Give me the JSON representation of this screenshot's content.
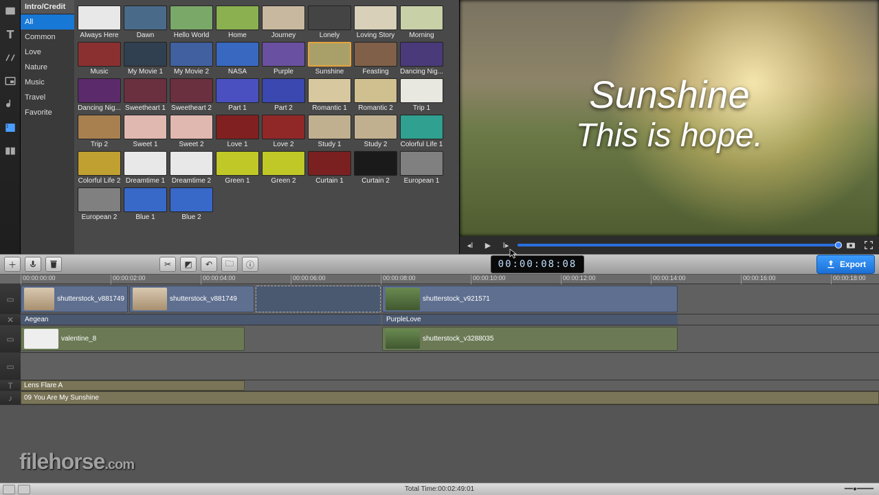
{
  "header_title": "Intro/Credit",
  "categories": [
    "All",
    "Common",
    "Love",
    "Nature",
    "Music",
    "Travel",
    "Favorite"
  ],
  "selected_category": 0,
  "templates": [
    {
      "label": "Always Here",
      "bg": "#e8e8e8"
    },
    {
      "label": "Dawn",
      "bg": "#4a6a8a"
    },
    {
      "label": "Hello World",
      "bg": "#7aa868"
    },
    {
      "label": "Home",
      "bg": "#8ab050"
    },
    {
      "label": "Journey",
      "bg": "#c8b8a0"
    },
    {
      "label": "Lonely",
      "bg": "#444"
    },
    {
      "label": "Loving Story",
      "bg": "#d8d0b8"
    },
    {
      "label": "Morning",
      "bg": "#c8d0a8"
    },
    {
      "label": "Music",
      "bg": "#8a3030"
    },
    {
      "label": "My Movie 1",
      "bg": "#304050"
    },
    {
      "label": "My Movie 2",
      "bg": "#4060a0"
    },
    {
      "label": "NASA",
      "bg": "#3868c0"
    },
    {
      "label": "Purple",
      "bg": "#6a50a0"
    },
    {
      "label": "Sunshine",
      "bg": "#a8a068",
      "sel": true
    },
    {
      "label": "Feasting",
      "bg": "#806048"
    },
    {
      "label": "Dancing Nig...",
      "bg": "#4a3a7a"
    },
    {
      "label": "Dancing Nig...",
      "bg": "#5a2a6a"
    },
    {
      "label": "Sweetheart 1",
      "bg": "#6a3040"
    },
    {
      "label": "Sweetheart 2",
      "bg": "#6a3040"
    },
    {
      "label": "Part 1",
      "bg": "#4a50c0"
    },
    {
      "label": "Part 2",
      "bg": "#3a48b0"
    },
    {
      "label": "Romantic 1",
      "bg": "#d8c8a0"
    },
    {
      "label": "Romantic 2",
      "bg": "#d0c090"
    },
    {
      "label": "Trip 1",
      "bg": "#e8e8e0"
    },
    {
      "label": "Trip 2",
      "bg": "#a88050"
    },
    {
      "label": "Sweet 1",
      "bg": "#e0b8b0"
    },
    {
      "label": "Sweet 2",
      "bg": "#e0b8b0"
    },
    {
      "label": "Love 1",
      "bg": "#802020"
    },
    {
      "label": "Love 2",
      "bg": "#902828"
    },
    {
      "label": "Study 1",
      "bg": "#c0b090"
    },
    {
      "label": "Study 2",
      "bg": "#c0b090"
    },
    {
      "label": "Colorful Life 1",
      "bg": "#30a090"
    },
    {
      "label": "Colorful Life 2",
      "bg": "#c0a030"
    },
    {
      "label": "Dreamtime 1",
      "bg": "#e8e8e8"
    },
    {
      "label": "Dreamtime 2",
      "bg": "#e8e8e8"
    },
    {
      "label": "Green 1",
      "bg": "#c0c828"
    },
    {
      "label": "Green 2",
      "bg": "#c0c828"
    },
    {
      "label": "Curtain 1",
      "bg": "#7a2020"
    },
    {
      "label": "Curtain 2",
      "bg": "#1a1a1a"
    },
    {
      "label": "European 1",
      "bg": "#808080"
    },
    {
      "label": "European 2",
      "bg": "#808080"
    },
    {
      "label": "Blue 1",
      "bg": "#3868c8"
    },
    {
      "label": "Blue 2",
      "bg": "#3868c8"
    }
  ],
  "preview": {
    "line1": "Sunshine",
    "line2": "This is hope."
  },
  "timecode": "00:00:08:08",
  "export_label": "Export",
  "ruler": [
    "00:00:00:00",
    "00:00:02:00",
    "00:00:04:00",
    "00:00:06:00",
    "00:00:08:00",
    "00:00:10:00",
    "00:00:12:00",
    "00:00:14:00",
    "00:00:16:00",
    "00:00:18:00"
  ],
  "clips": {
    "v1a": "shutterstock_v881749",
    "v1b": "shutterstock_v881749",
    "v1c": "shutterstock_v921571",
    "e1": "Aegean",
    "e2": "PurpleLove",
    "a1": "valentine_8",
    "a2": "shutterstock_v3288035",
    "t1": "Lens Flare A",
    "m1": "09 You Are My Sunshine"
  },
  "footer": {
    "total": "Total Time:00:02:49:01"
  },
  "watermark": {
    "a": "filehorse",
    "b": ".com"
  }
}
